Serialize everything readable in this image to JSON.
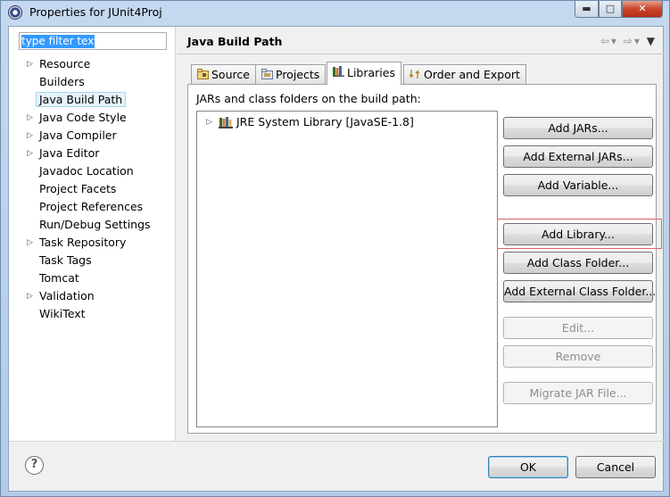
{
  "window": {
    "title": "Properties for JUnit4Proj",
    "controls": {
      "minimize": "▬",
      "maximize": "□",
      "close": "✕"
    }
  },
  "filter": {
    "placeholder": "type filter text",
    "value": "type filter text"
  },
  "tree": {
    "items": [
      {
        "label": "Resource",
        "expandable": true
      },
      {
        "label": "Builders",
        "expandable": false
      },
      {
        "label": "Java Build Path",
        "expandable": false,
        "selected": true
      },
      {
        "label": "Java Code Style",
        "expandable": true
      },
      {
        "label": "Java Compiler",
        "expandable": true
      },
      {
        "label": "Java Editor",
        "expandable": true
      },
      {
        "label": "Javadoc Location",
        "expandable": false
      },
      {
        "label": "Project Facets",
        "expandable": false
      },
      {
        "label": "Project References",
        "expandable": false
      },
      {
        "label": "Run/Debug Settings",
        "expandable": false
      },
      {
        "label": "Task Repository",
        "expandable": true
      },
      {
        "label": "Task Tags",
        "expandable": false
      },
      {
        "label": "Tomcat",
        "expandable": false
      },
      {
        "label": "Validation",
        "expandable": true
      },
      {
        "label": "WikiText",
        "expandable": false
      }
    ]
  },
  "page": {
    "title": "Java Build Path",
    "tabs": [
      {
        "label": "Source",
        "icon": "source-folder-icon"
      },
      {
        "label": "Projects",
        "icon": "projects-icon"
      },
      {
        "label": "Libraries",
        "icon": "libraries-icon",
        "active": true
      },
      {
        "label": "Order and Export",
        "icon": "order-export-icon"
      }
    ],
    "description": "JARs and class folders on the build path:",
    "libraries": [
      {
        "label": "JRE System Library [JavaSE-1.8]",
        "icon": "library-icon"
      }
    ],
    "buttons": [
      {
        "label": "Add JARs...",
        "enabled": true
      },
      {
        "label": "Add External JARs...",
        "enabled": true
      },
      {
        "label": "Add Variable...",
        "enabled": true
      },
      {
        "label": "Add Library...",
        "enabled": true,
        "highlighted": true
      },
      {
        "label": "Add Class Folder...",
        "enabled": true
      },
      {
        "label": "Add External Class Folder...",
        "enabled": true
      },
      {
        "label": "Edit...",
        "enabled": false
      },
      {
        "label": "Remove",
        "enabled": false
      },
      {
        "label": "Migrate JAR File...",
        "enabled": false
      }
    ]
  },
  "footer": {
    "help": "?",
    "ok": "OK",
    "cancel": "Cancel"
  },
  "colors": {
    "highlight": "#e06060",
    "selection": "#3399ff",
    "tree_selected_bg": "#e5f3fb"
  }
}
